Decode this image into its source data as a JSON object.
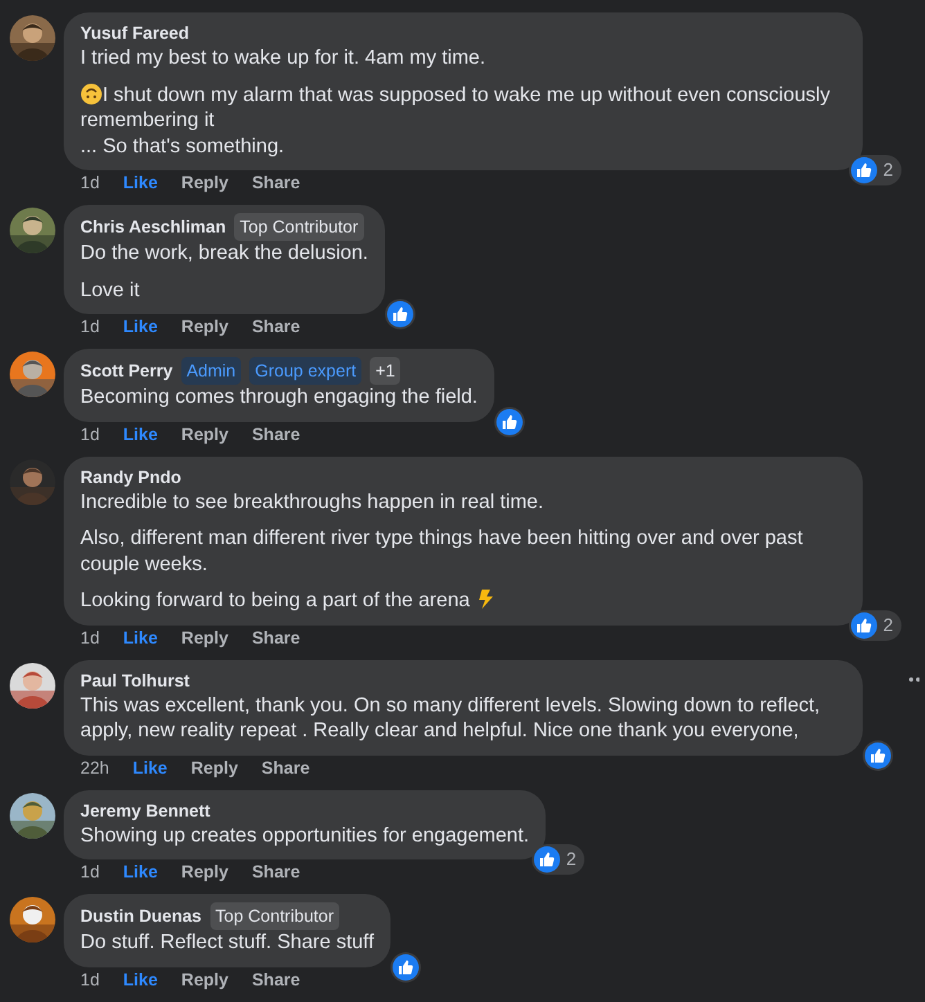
{
  "comments": [
    {
      "avatar": {
        "kind": "picture"
      },
      "author": "Yusuf Fareed",
      "paragraphs": [
        {
          "text": "I tried my best to wake up for it. 4am my time."
        },
        {
          "text": "I shut down my alarm that was supposed to wake me up without even consciously remembering it\n... So that's something.",
          "emoji_before": {
            "kind": "upside-down"
          }
        }
      ],
      "time": "1d",
      "actions": [
        {
          "label": "Like",
          "kind": "like"
        },
        {
          "label": "Reply",
          "kind": "plain"
        },
        {
          "label": "Share",
          "kind": "plain"
        }
      ],
      "reaction_count": "2"
    },
    {
      "avatar": {
        "kind": "picture"
      },
      "author": "Chris Aeschliman",
      "badges": [
        {
          "label": "Top Contributor",
          "kind": "neutral"
        }
      ],
      "paragraphs": [
        {
          "text": "Do the work, break the delusion."
        },
        {
          "text": "Love it"
        }
      ],
      "time": "1d",
      "actions": [
        {
          "label": "Like",
          "kind": "like"
        },
        {
          "label": "Reply",
          "kind": "plain"
        },
        {
          "label": "Share",
          "kind": "plain"
        }
      ]
    },
    {
      "avatar": {
        "kind": "picture"
      },
      "author": "Scott Perry",
      "badges": [
        {
          "label": "Admin",
          "kind": "role"
        },
        {
          "label": "Group expert",
          "kind": "role"
        },
        {
          "label": "+1",
          "kind": "neutral"
        }
      ],
      "paragraphs": [
        {
          "text": "Becoming comes through engaging the field."
        }
      ],
      "time": "1d",
      "actions": [
        {
          "label": "Like",
          "kind": "like"
        },
        {
          "label": "Reply",
          "kind": "plain"
        },
        {
          "label": "Share",
          "kind": "plain"
        }
      ]
    },
    {
      "avatar": {
        "kind": "picture"
      },
      "author": "Randy Pndo",
      "paragraphs": [
        {
          "text": "Incredible to see breakthroughs happen in real time."
        },
        {
          "text": "Also, different man different river type things have been hitting over and over past couple weeks."
        },
        {
          "text": "Looking forward to being a part of the arena",
          "emoji_after": {
            "kind": "lightning"
          }
        }
      ],
      "time": "1d",
      "actions": [
        {
          "label": "Like",
          "kind": "like"
        },
        {
          "label": "Reply",
          "kind": "plain"
        },
        {
          "label": "Share",
          "kind": "plain"
        }
      ],
      "reaction_count": "2"
    },
    {
      "avatar": {
        "kind": "picture"
      },
      "author": "Paul Tolhurst",
      "paragraphs": [
        {
          "text": "This was excellent, thank you. On so many different levels. Slowing down to reflect, apply, new reality repeat . Really clear and helpful. Nice one thank you everyone,"
        }
      ],
      "time": "22h",
      "actions": [
        {
          "label": "Like",
          "kind": "like"
        },
        {
          "label": "Reply",
          "kind": "plain"
        },
        {
          "label": "Share",
          "kind": "plain"
        }
      ],
      "menu_visible": true
    },
    {
      "avatar": {
        "kind": "picture"
      },
      "author": "Jeremy Bennett",
      "paragraphs": [
        {
          "text": "Showing up creates opportunities for engagement."
        }
      ],
      "time": "1d",
      "actions": [
        {
          "label": "Like",
          "kind": "like"
        },
        {
          "label": "Reply",
          "kind": "plain"
        },
        {
          "label": "Share",
          "kind": "plain"
        }
      ],
      "reaction_count": "2"
    },
    {
      "avatar": {
        "kind": "picture"
      },
      "author": "Dustin Duenas",
      "badges": [
        {
          "label": "Top Contributor",
          "kind": "neutral"
        }
      ],
      "paragraphs": [
        {
          "text": "Do stuff. Reflect stuff. Share stuff"
        }
      ],
      "time": "1d",
      "actions": [
        {
          "label": "Like",
          "kind": "like"
        },
        {
          "label": "Reply",
          "kind": "plain"
        },
        {
          "label": "Share",
          "kind": "plain"
        }
      ]
    }
  ]
}
